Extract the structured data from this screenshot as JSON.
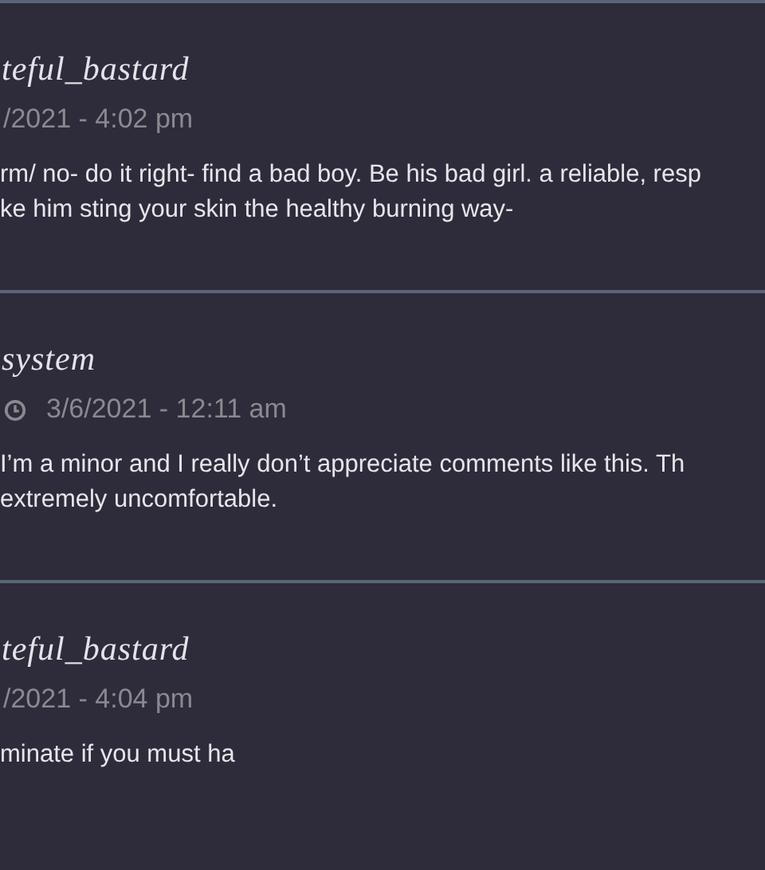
{
  "comments": [
    {
      "author": "teful_bastard",
      "clock": false,
      "date": "/2021 - 4:02 pm",
      "lines": [
        "rm/ no- do it right- find a bad boy. Be his bad girl. a reliable, resp",
        "ke him sting your skin the healthy burning way-"
      ]
    },
    {
      "author": "system",
      "clock": true,
      "date": "3/6/2021 - 12:11 am",
      "lines": [
        "I’m a minor and I really don’t appreciate comments like this. Th",
        "extremely uncomfortable."
      ]
    },
    {
      "author": "teful_bastard",
      "clock": false,
      "date": "/2021 - 4:04 pm",
      "lines": [
        "minate if you must ha"
      ]
    }
  ]
}
